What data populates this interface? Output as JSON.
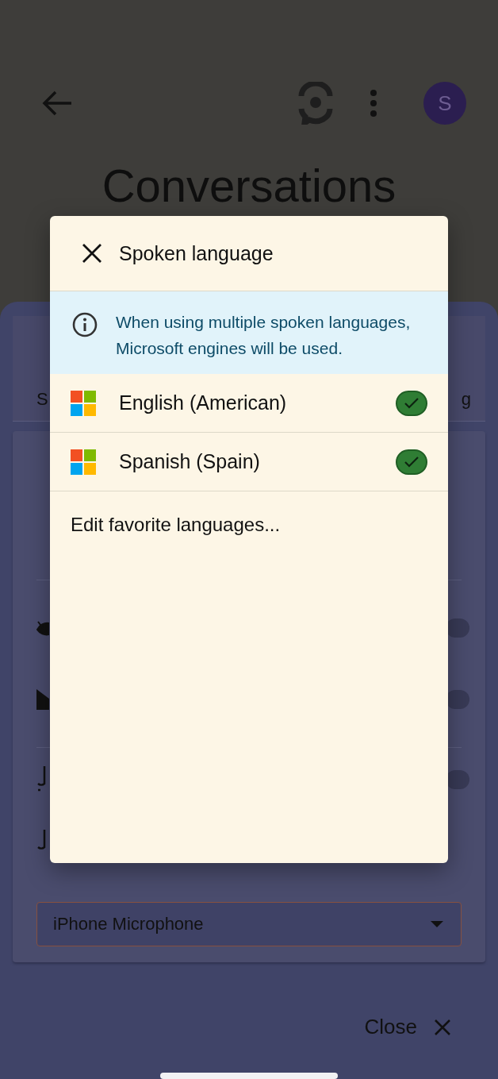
{
  "header": {
    "avatar_letter": "S",
    "title": "Conversations"
  },
  "sheet": {
    "tab_edge_left": "S",
    "tab_edge_right": "g",
    "microphone": {
      "value": "iPhone Microphone"
    },
    "close_label": "Close",
    "toggles": [
      {
        "on": false
      },
      {
        "on": false
      },
      {
        "on": false
      }
    ]
  },
  "dialog": {
    "title": "Spoken language",
    "notice": "When using multiple spoken languages, Microsoft engines will be used.",
    "languages": [
      {
        "label": "English (American)",
        "checked": true
      },
      {
        "label": "Spanish (Spain)",
        "checked": true
      }
    ],
    "edit_link": "Edit favorite languages..."
  }
}
